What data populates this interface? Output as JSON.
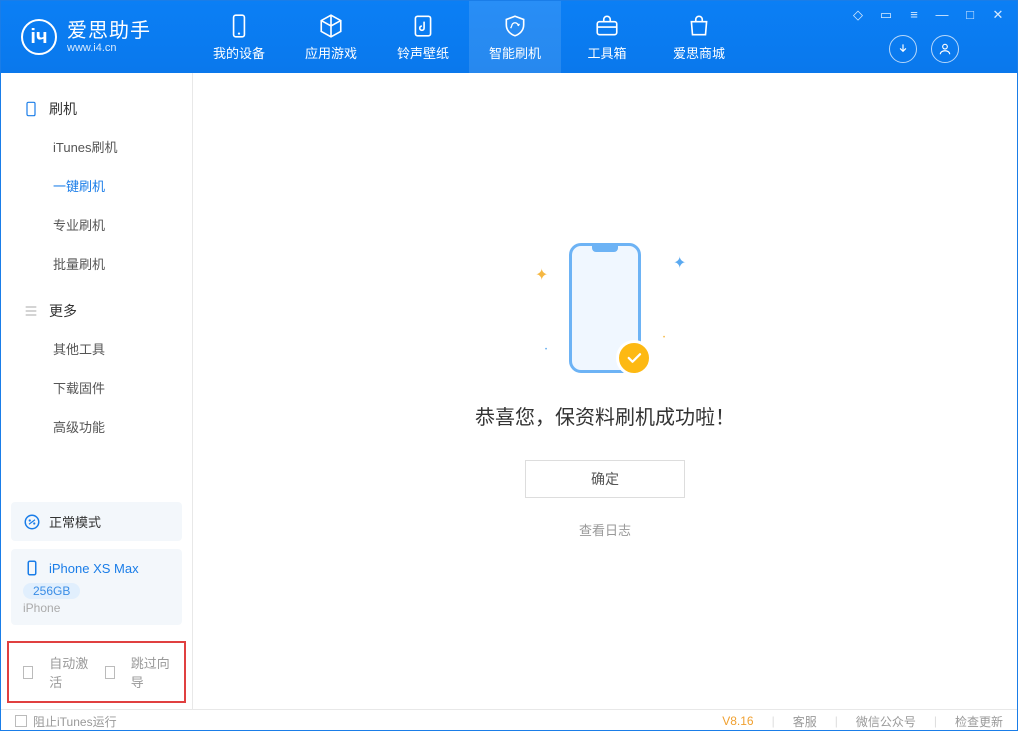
{
  "app": {
    "title": "爱思助手",
    "url": "www.i4.cn"
  },
  "nav": [
    {
      "label": "我的设备"
    },
    {
      "label": "应用游戏"
    },
    {
      "label": "铃声壁纸"
    },
    {
      "label": "智能刷机"
    },
    {
      "label": "工具箱"
    },
    {
      "label": "爱思商城"
    }
  ],
  "sidebar": {
    "section1": {
      "title": "刷机",
      "items": [
        "iTunes刷机",
        "一键刷机",
        "专业刷机",
        "批量刷机"
      ]
    },
    "section2": {
      "title": "更多",
      "items": [
        "其他工具",
        "下载固件",
        "高级功能"
      ]
    }
  },
  "device_mode": "正常模式",
  "device": {
    "name": "iPhone XS Max",
    "storage": "256GB",
    "type": "iPhone"
  },
  "checkboxes": {
    "auto_activate": "自动激活",
    "skip_guide": "跳过向导"
  },
  "main": {
    "success_text": "恭喜您，保资料刷机成功啦！",
    "ok": "确定",
    "log_link": "查看日志"
  },
  "status": {
    "block_itunes": "阻止iTunes运行",
    "version": "V8.16",
    "links": [
      "客服",
      "微信公众号",
      "检查更新"
    ]
  }
}
